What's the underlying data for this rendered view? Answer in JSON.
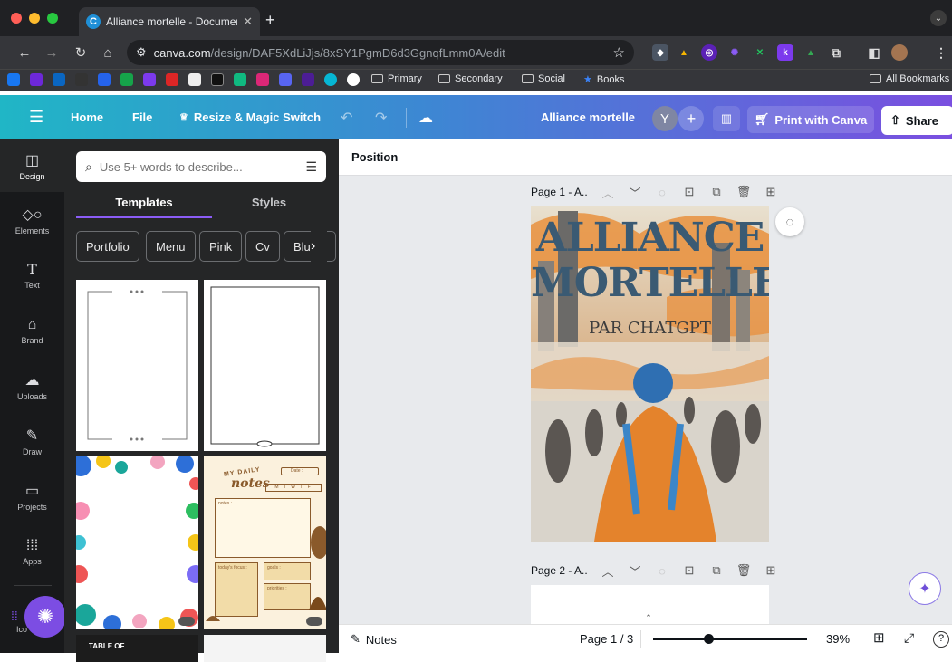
{
  "browser": {
    "tab_title": "Alliance mortelle - Document",
    "tab_favicon_letter": "C",
    "url_host": "canva.com",
    "url_path": "/design/DAF5XdLiJjs/8xSY1PgmD6d3GgnqfLmm0A/edit",
    "bookmarks": [
      "Primary",
      "Secondary",
      "Social",
      "Books"
    ],
    "all_bookmarks_label": "All Bookmarks"
  },
  "canva_topbar": {
    "home_label": "Home",
    "file_label": "File",
    "resize_label": "Resize & Magic Switch",
    "doc_title": "Alliance mortelle",
    "avatar_letter": "Y",
    "print_label": "Print with Canva",
    "share_label": "Share"
  },
  "rail": {
    "items": [
      {
        "label": "Design",
        "icon": "layout-icon"
      },
      {
        "label": "Elements",
        "icon": "shapes-icon"
      },
      {
        "label": "Text",
        "icon": "text-icon"
      },
      {
        "label": "Brand",
        "icon": "brand-icon"
      },
      {
        "label": "Uploads",
        "icon": "cloud-upload-icon"
      },
      {
        "label": "Draw",
        "icon": "pen-icon"
      },
      {
        "label": "Projects",
        "icon": "folder-icon"
      },
      {
        "label": "Apps",
        "icon": "grid-icon"
      }
    ],
    "bottom_label": "Ico"
  },
  "panel": {
    "search_placeholder": "Use 5+ words to describe...",
    "tabs": [
      "Templates",
      "Styles"
    ],
    "chips": [
      "Portfolio",
      "Menu",
      "Pink",
      "Cv",
      "Blue"
    ],
    "notes_template": {
      "title_top": "MY DAILY",
      "title_main": "notes",
      "date_label": "Date :",
      "weekdays": "M T W T F",
      "notes_label": "notes :",
      "focus_label": "today's focus :",
      "goals_label": "goals :",
      "priorities_label": "priorities :"
    },
    "toc_label": "TABLE OF"
  },
  "editor": {
    "context_label": "Position",
    "page1_label": "Page 1 - A..",
    "page2_label": "Page 2 - A..",
    "cover_title_1": "ALLIANCE",
    "cover_title_2": "MORTELLE",
    "cover_subtitle": "PAR CHATGPT"
  },
  "bottombar": {
    "notes_label": "Notes",
    "page_indicator": "Page 1 / 3",
    "zoom": "39%"
  },
  "colors": {
    "topbar_gradient_start": "#20b6c6",
    "topbar_gradient_end": "#7a4fe0",
    "panel_bg": "#252627",
    "rail_bg": "#18191b",
    "accent": "#8b5cf6"
  }
}
